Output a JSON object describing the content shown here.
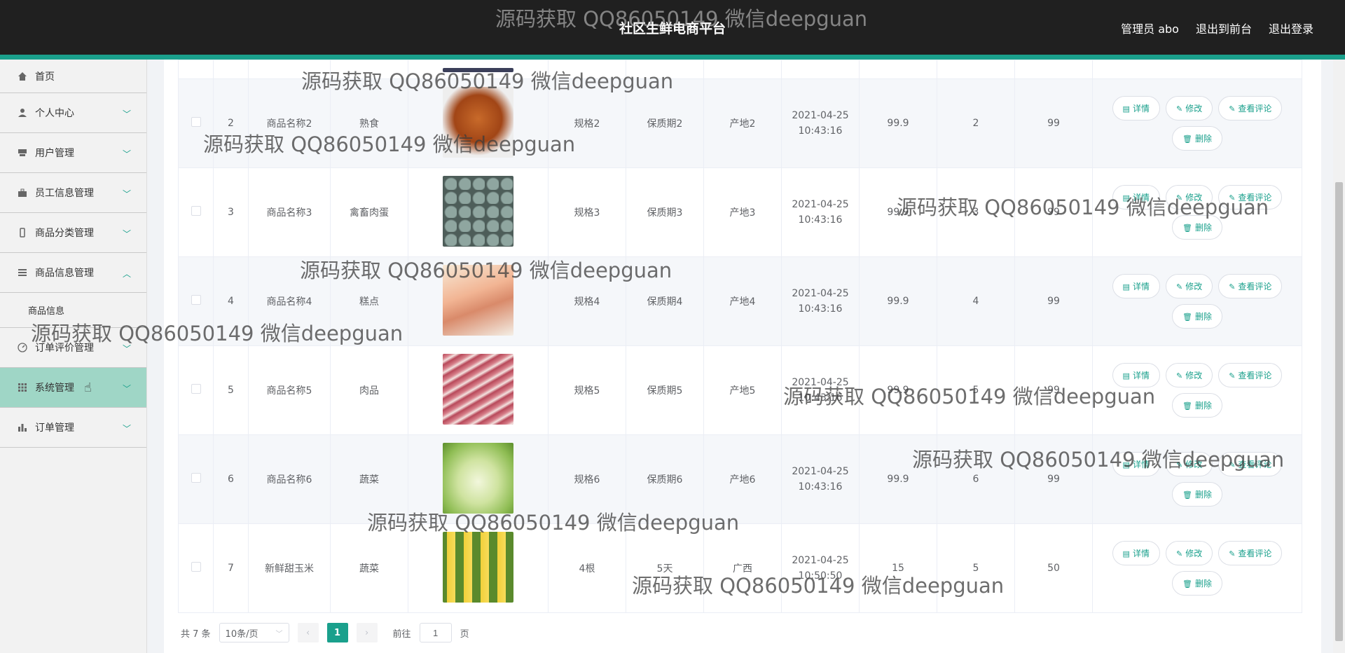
{
  "header": {
    "title": "社区生鲜电商平台",
    "actions": [
      "管理员 abo",
      "退出到前台",
      "退出登录"
    ],
    "accent": "#1aa08c"
  },
  "sidebar": {
    "items": [
      {
        "label": "首页",
        "icon": "home-icon"
      },
      {
        "label": "个人中心",
        "icon": "user-icon"
      },
      {
        "label": "用户管理",
        "icon": "users-icon"
      },
      {
        "label": "员工信息管理",
        "icon": "briefcase-icon"
      },
      {
        "label": "商品分类管理",
        "icon": "phone-icon"
      },
      {
        "label": "商品信息管理",
        "icon": "list-icon"
      },
      {
        "label": "订单评价管理",
        "icon": "compass-icon"
      },
      {
        "label": "系统管理",
        "icon": "grid-icon"
      },
      {
        "label": "订单管理",
        "icon": "chart-icon"
      }
    ],
    "submenu": "商品信息"
  },
  "table": {
    "rows": [
      {
        "id": "2",
        "name": "商品名称2",
        "category": "熟食",
        "spec": "规格2",
        "shelf": "保质期2",
        "origin": "产地2",
        "date": "2021-04-25",
        "time": "10:43:16",
        "price": "99.9",
        "sales": "2",
        "stock": "99"
      },
      {
        "id": "3",
        "name": "商品名称3",
        "category": "禽畜肉蛋",
        "spec": "规格3",
        "shelf": "保质期3",
        "origin": "产地3",
        "date": "2021-04-25",
        "time": "10:43:16",
        "price": "99.9",
        "sales": "3",
        "stock": "99"
      },
      {
        "id": "4",
        "name": "商品名称4",
        "category": "糕点",
        "spec": "规格4",
        "shelf": "保质期4",
        "origin": "产地4",
        "date": "2021-04-25",
        "time": "10:43:16",
        "price": "99.9",
        "sales": "4",
        "stock": "99"
      },
      {
        "id": "5",
        "name": "商品名称5",
        "category": "肉品",
        "spec": "规格5",
        "shelf": "保质期5",
        "origin": "产地5",
        "date": "2021-04-25",
        "time": "10:43:16",
        "price": "99.9",
        "sales": "5",
        "stock": "99"
      },
      {
        "id": "6",
        "name": "商品名称6",
        "category": "蔬菜",
        "spec": "规格6",
        "shelf": "保质期6",
        "origin": "产地6",
        "date": "2021-04-25",
        "time": "10:43:16",
        "price": "99.9",
        "sales": "6",
        "stock": "99"
      },
      {
        "id": "7",
        "name": "新鲜甜玉米",
        "category": "蔬菜",
        "spec": "4根",
        "shelf": "5天",
        "origin": "广西",
        "date": "2021-04-25",
        "time": "10:50:50",
        "price": "15",
        "sales": "5",
        "stock": "50"
      }
    ],
    "buttons": {
      "detail": "详情",
      "edit": "修改",
      "reviews": "查看评论",
      "delete": "删除"
    }
  },
  "pagination": {
    "total": "共 7 条",
    "page_size": "10条/页",
    "current_page": "1",
    "goto_prefix": "前往",
    "goto_value": "1",
    "goto_suffix": "页"
  },
  "watermark": "源码获取 QQ86050149 微信deepguan"
}
